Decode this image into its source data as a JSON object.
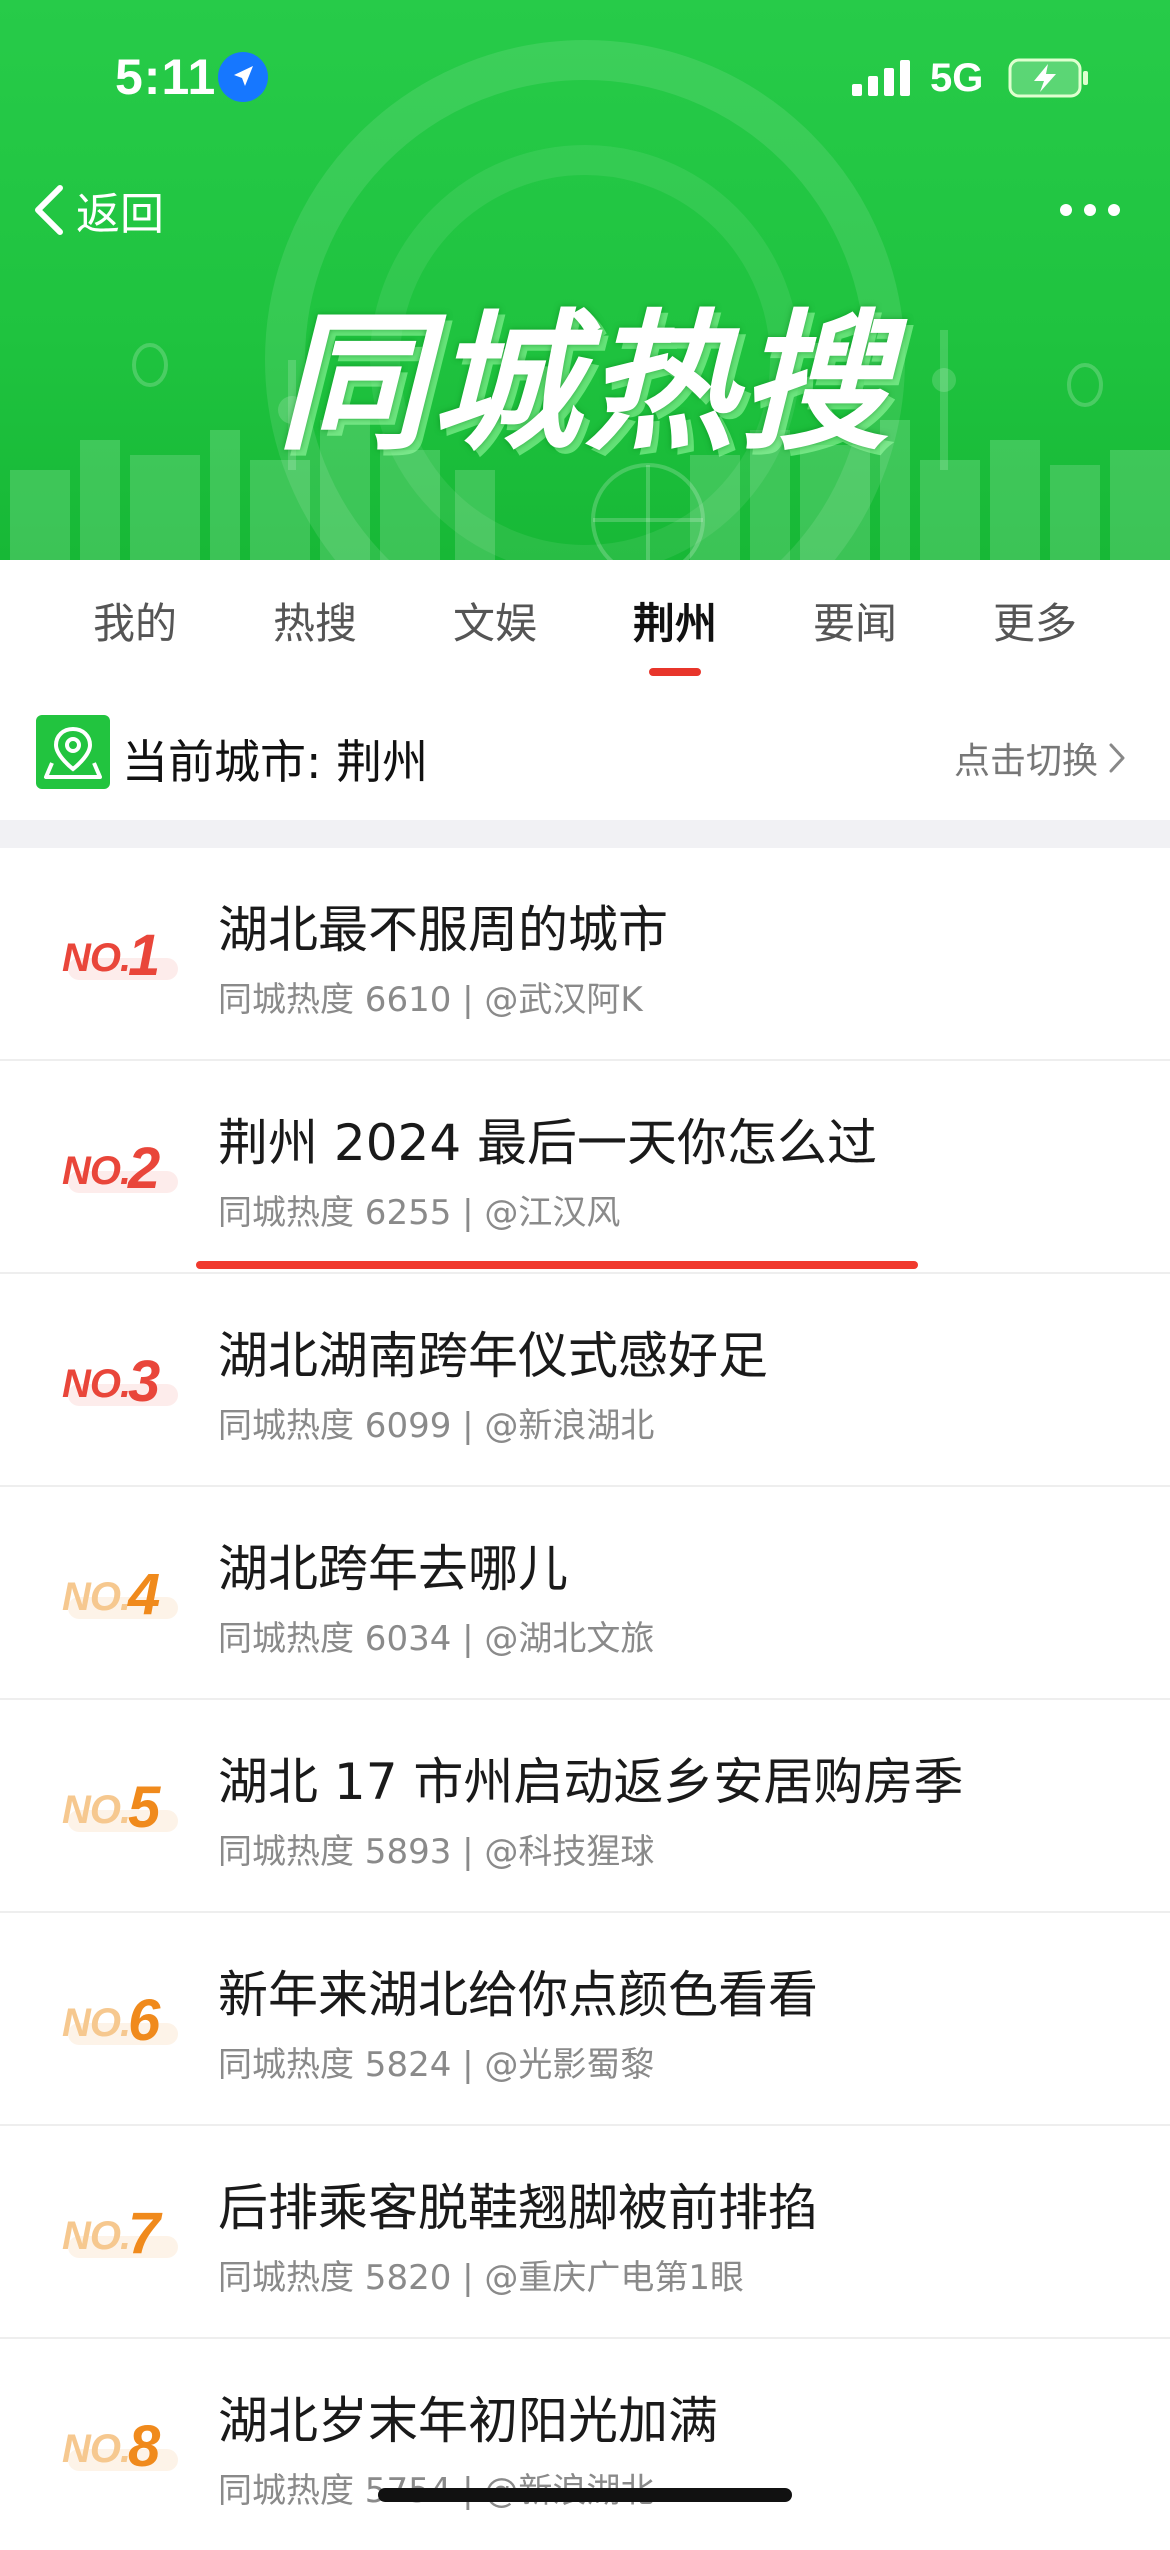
{
  "status_bar": {
    "time": "5:11",
    "network": "5G"
  },
  "nav": {
    "back_label": "返回",
    "more_icon": "more-dots-icon"
  },
  "banner": {
    "title": "同城热搜",
    "color": "#21c641"
  },
  "tabs": [
    {
      "label": "我的",
      "active": false
    },
    {
      "label": "热搜",
      "active": false
    },
    {
      "label": "文娱",
      "active": false
    },
    {
      "label": "荆州",
      "active": true
    },
    {
      "label": "要闻",
      "active": false
    },
    {
      "label": "更多",
      "active": false
    }
  ],
  "city": {
    "label": "当前城市: 荆州",
    "switch_label": "点击切换",
    "icon": "location-pin-icon"
  },
  "hot_list": [
    {
      "rank_prefix": "NO.",
      "rank": "1",
      "title": "湖北最不服周的城市",
      "meta": "同城热度 6610 | @武汉阿K"
    },
    {
      "rank_prefix": "NO.",
      "rank": "2",
      "title": "荆州 2024 最后一天你怎么过",
      "meta": "同城热度 6255 | @江汉风"
    },
    {
      "rank_prefix": "NO.",
      "rank": "3",
      "title": "湖北湖南跨年仪式感好足",
      "meta": "同城热度 6099 | @新浪湖北"
    },
    {
      "rank_prefix": "NO.",
      "rank": "4",
      "title": "湖北跨年去哪儿",
      "meta": "同城热度 6034 | @湖北文旅"
    },
    {
      "rank_prefix": "NO.",
      "rank": "5",
      "title": "湖北 17 市州启动返乡安居购房季",
      "meta": "同城热度 5893 | @科技猩球"
    },
    {
      "rank_prefix": "NO.",
      "rank": "6",
      "title": "新年来湖北给你点颜色看看",
      "meta": "同城热度 5824 | @光影蜀黎"
    },
    {
      "rank_prefix": "NO.",
      "rank": "7",
      "title": "后排乘客脱鞋翘脚被前排掐",
      "meta": "同城热度 5820 | @重庆广电第1眼"
    },
    {
      "rank_prefix": "NO.",
      "rank": "8",
      "title": "湖北岁末年初阳光加满",
      "meta": "同城热度 5754 | @新浪湖北"
    }
  ],
  "colors": {
    "top_rank": "#e9463a",
    "other_rank": "#f08a1c",
    "tab_indicator": "#e8352b",
    "highlight_underline": "#f03a2e"
  }
}
